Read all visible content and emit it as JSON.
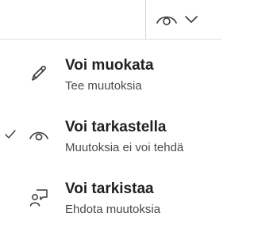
{
  "toolbar": {
    "mode_icon": "eye-icon",
    "dropdown_icon": "chevron-down-icon"
  },
  "menu": {
    "items": [
      {
        "icon": "pencil-icon",
        "title": "Voi muokata",
        "subtitle": "Tee muutoksia",
        "selected": false
      },
      {
        "icon": "eye-icon",
        "title": "Voi tarkastella",
        "subtitle": "Muutoksia ei voi tehdä",
        "selected": true
      },
      {
        "icon": "person-comment-icon",
        "title": "Voi tarkistaa",
        "subtitle": "Ehdota muutoksia",
        "selected": false
      }
    ]
  },
  "colors": {
    "text_primary": "#201f1e",
    "text_secondary": "#4a4a4a",
    "icon": "#3b3a39"
  }
}
